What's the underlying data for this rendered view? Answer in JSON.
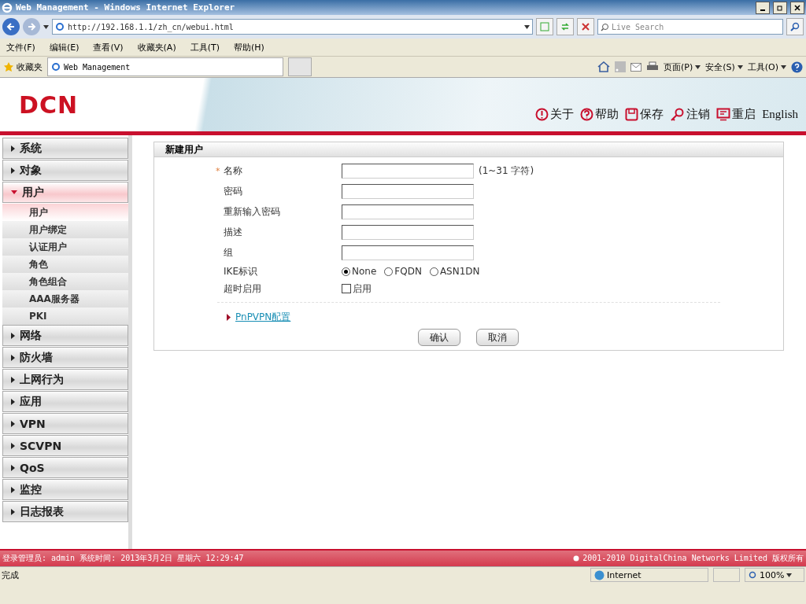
{
  "window": {
    "title": "Web Management - Windows Internet Explorer"
  },
  "address_bar": {
    "url": "http://192.168.1.1/zh_cn/webui.html",
    "search_placeholder": "Live Search"
  },
  "menu_bar": [
    "文件(F)",
    "编辑(E)",
    "查看(V)",
    "收藏夹(A)",
    "工具(T)",
    "帮助(H)"
  ],
  "favorites_bar": {
    "favorites": "收藏夹",
    "tab": "Web Management",
    "commands": [
      "页面(P)",
      "安全(S)",
      "工具(O)"
    ]
  },
  "header": {
    "logo": "DCN",
    "links": [
      {
        "kind": "about",
        "label": "关于"
      },
      {
        "kind": "help",
        "label": "帮助"
      },
      {
        "kind": "save",
        "label": "保存"
      },
      {
        "kind": "logout",
        "label": "注销"
      },
      {
        "kind": "reboot",
        "label": "重启"
      },
      {
        "kind": "text",
        "label": "English"
      }
    ]
  },
  "sidebar": {
    "items": [
      {
        "label": "系统",
        "expanded": false
      },
      {
        "label": "对象",
        "expanded": false
      },
      {
        "label": "用户",
        "expanded": true,
        "children": [
          {
            "label": "用户",
            "selected": true
          },
          {
            "label": "用户绑定",
            "selected": false
          },
          {
            "label": "认证用户",
            "selected": false
          },
          {
            "label": "角色",
            "selected": false
          },
          {
            "label": "角色组合",
            "selected": false
          },
          {
            "label": "AAA服务器",
            "selected": false
          },
          {
            "label": "PKI",
            "selected": false
          }
        ]
      },
      {
        "label": "网络",
        "expanded": false
      },
      {
        "label": "防火墙",
        "expanded": false
      },
      {
        "label": "上网行为",
        "expanded": false
      },
      {
        "label": "应用",
        "expanded": false
      },
      {
        "label": "VPN",
        "expanded": false
      },
      {
        "label": "SCVPN",
        "expanded": false
      },
      {
        "label": "QoS",
        "expanded": false
      },
      {
        "label": "监控",
        "expanded": false
      },
      {
        "label": "日志报表",
        "expanded": false
      }
    ]
  },
  "form": {
    "title": "新建用户",
    "required_mark": "*",
    "fields": [
      {
        "kind": "text",
        "label": "名称",
        "required": true,
        "hint": "(1~31 字符)"
      },
      {
        "kind": "text",
        "label": "密码",
        "required": false
      },
      {
        "kind": "text",
        "label": "重新输入密码",
        "required": false
      },
      {
        "kind": "text",
        "label": "描述",
        "required": false
      },
      {
        "kind": "text",
        "label": "组",
        "required": false
      },
      {
        "kind": "radio",
        "label": "IKE标识",
        "required": false,
        "options": [
          {
            "label": "None",
            "selected": true
          },
          {
            "label": "FQDN",
            "selected": false
          },
          {
            "label": "ASN1DN",
            "selected": false
          }
        ]
      },
      {
        "kind": "checkbox",
        "label": "超时启用",
        "required": false,
        "option": "启用",
        "checked": false
      }
    ],
    "link": "PnPVPN配置",
    "buttons": [
      "确认",
      "取消"
    ]
  },
  "footer": {
    "login": "登录管理员: admin 系统时间: 2013年3月2日 星期六 12:29:47",
    "copyright": "2001-2010 DigitalChina Networks Limited 版权所有"
  },
  "status_bar": {
    "text": "完成",
    "zone": "Internet",
    "zoom": "100%"
  }
}
